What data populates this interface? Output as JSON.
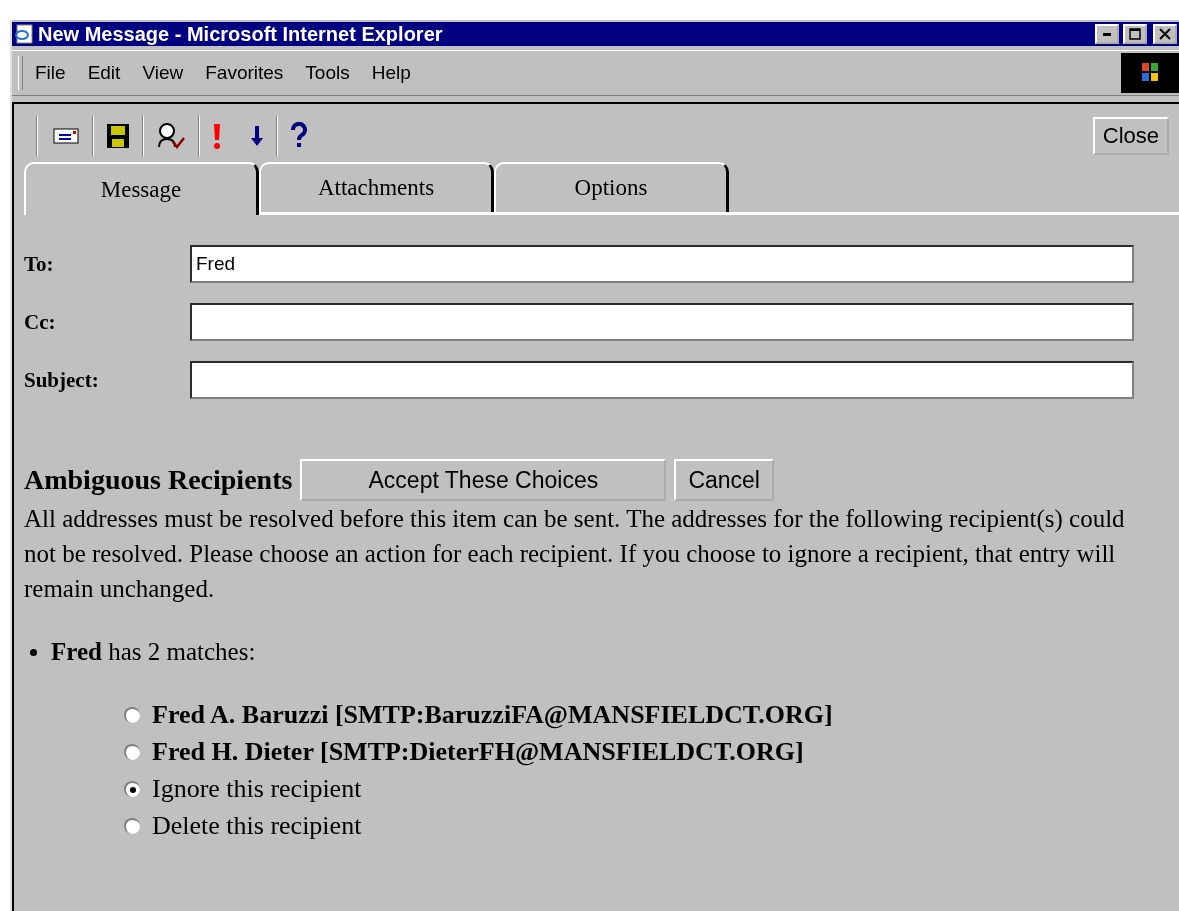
{
  "window": {
    "title": "New Message - Microsoft Internet Explorer"
  },
  "menu": [
    "File",
    "Edit",
    "View",
    "Favorites",
    "Tools",
    "Help"
  ],
  "toolbar": {
    "close_button": "Close"
  },
  "tabs": [
    {
      "label": "Message",
      "selected": true
    },
    {
      "label": "Attachments",
      "selected": false
    },
    {
      "label": "Options",
      "selected": false
    }
  ],
  "fields": [
    {
      "label": "To:",
      "value": "Fred"
    },
    {
      "label": "Cc:"
    },
    {
      "label": "Subject:"
    }
  ],
  "ambiguous": {
    "title": "Ambiguous Recipients",
    "accept_button": "Accept These Choices",
    "cancel_button": "Cancel",
    "message": "All addresses must be resolved before this item can be sent. The addresses for the following recipient(s) could not be resolved. Please choose an action for each recipient. If you choose to ignore a recipient, that entry will remain unchanged.",
    "recipient": "**Fred** has 2 matches:",
    "options": [
      {
        "kind": "match",
        "label": "Fred A. Baruzzi [SMTP:BaruzziFA@MANSFIELDCT.ORG]",
        "selected": false
      },
      {
        "kind": "match",
        "label": "Fred H. Dieter [SMTP:DieterFH@MANSFIELDCT.ORG]",
        "selected": false
      },
      {
        "kind": "action",
        "label": "Ignore this recipient",
        "selected": true
      },
      {
        "kind": "action",
        "label": "Delete this recipient",
        "selected": false
      }
    ]
  }
}
